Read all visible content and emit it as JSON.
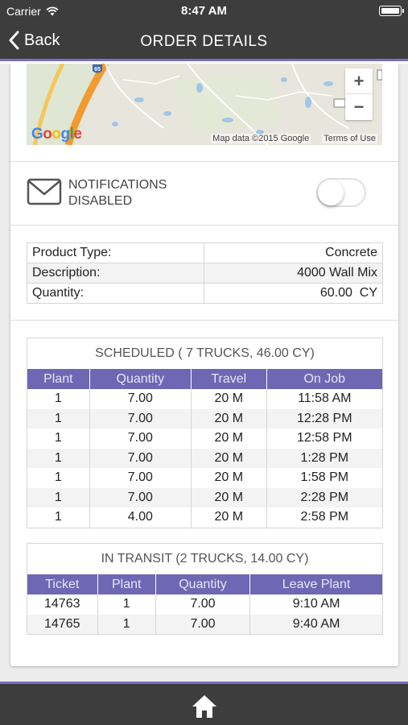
{
  "status_bar": {
    "carrier": "Carrier",
    "time": "8:47 AM",
    "icons": [
      "wifi-icon",
      "battery-icon"
    ]
  },
  "nav": {
    "back_label": "Back",
    "title": "ORDER DETAILS",
    "icon": "chevron-left-icon"
  },
  "map": {
    "google_logo": [
      "G",
      "o",
      "o",
      "g",
      "l",
      "e"
    ],
    "zoom_in": "+",
    "zoom_out": "−",
    "highway_shield": "65",
    "map_data": "Map data ©2015 Google",
    "terms": "Terms of Use"
  },
  "notifications": {
    "icon": "envelope-icon",
    "label": "NOTIFICATIONS DISABLED",
    "enabled": false
  },
  "product": {
    "rows": [
      {
        "label": "Product Type:",
        "value": "Concrete"
      },
      {
        "label": "Description:",
        "value": "4000 Wall Mix"
      },
      {
        "label": "Quantity:",
        "value": "60.00  CY"
      }
    ]
  },
  "scheduled": {
    "title": "SCHEDULED ( 7 TRUCKS, 46.00 CY)",
    "columns": [
      "Plant",
      "Quantity",
      "Travel",
      "On Job"
    ],
    "rows": [
      [
        "1",
        "7.00",
        "20 M",
        "11:58 AM"
      ],
      [
        "1",
        "7.00",
        "20 M",
        "12:28 PM"
      ],
      [
        "1",
        "7.00",
        "20 M",
        "12:58 PM"
      ],
      [
        "1",
        "7.00",
        "20 M",
        "1:28 PM"
      ],
      [
        "1",
        "7.00",
        "20 M",
        "1:58 PM"
      ],
      [
        "1",
        "7.00",
        "20 M",
        "2:28 PM"
      ],
      [
        "1",
        "4.00",
        "20 M",
        "2:58 PM"
      ]
    ]
  },
  "in_transit": {
    "title": "IN TRANSIT (2 TRUCKS, 14.00 CY)",
    "columns": [
      "Ticket",
      "Plant",
      "Quantity",
      "Leave Plant"
    ],
    "rows": [
      [
        "14763",
        "1",
        "7.00",
        "9:10 AM"
      ],
      [
        "14765",
        "1",
        "7.00",
        "9:40 AM"
      ]
    ]
  },
  "bottom_bar": {
    "icon": "home-icon"
  },
  "colors": {
    "bar_bg": "#3d3d3d",
    "accent": "#7a70c0",
    "table_header": "#6e67b4"
  }
}
